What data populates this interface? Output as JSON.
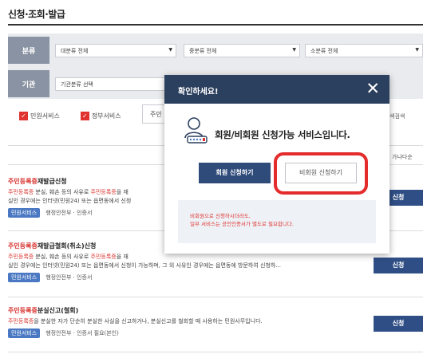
{
  "page": {
    "title": "신청·조회·발급"
  },
  "filters": {
    "category_label": "분류",
    "agency_label": "기관",
    "major_select": "대분류 전체",
    "middle_select": "중분류 전체",
    "minor_select": "소분류 전체",
    "agency_select": "기관분류 선택",
    "check_civil": "민원서비스",
    "check_gov": "정부서비스",
    "chip_partial": "주민",
    "detail_search": "색검색",
    "sort_partial": "가나다순"
  },
  "results": [
    {
      "title_hl": "주민등록증",
      "title_rest": "재발급신청",
      "desc1_hl": "주민등록증",
      "desc1_mid": " 분실, 훼손 등의 사유로 ",
      "desc1_hl2": "주민등록증",
      "desc1_rest": "을 재",
      "desc2": "실인 경우에는 인터넷(민원24) 또는 읍면동에서 신청",
      "tag": "민원서비스",
      "meta": "행정안전부 · 인증서",
      "button": "신청"
    },
    {
      "title_hl": "주민등록증",
      "title_rest": "재발급철회(취소)신청",
      "desc1_hl": "주민등록증",
      "desc1_mid": " 분실, 훼손 등의 사유로 ",
      "desc1_hl2": "주민등록증",
      "desc1_rest": "을 재",
      "desc2": "실인 경우에는 인터넷(민원24) 또는 읍면동에서 신청이 가능하며, 그 외 사유인 경우에는 읍면동에 방문하여 신청하...",
      "tag": "민원서비스",
      "meta": "행정안전부 · 인증서",
      "button": "신청"
    },
    {
      "title_hl": "주민등록증",
      "title_rest": "분실신고(철회)",
      "desc1_hl": "주민등록증",
      "desc1_mid": "을 분실한 자가 단순히 분실한 사실을 신고하거나, 분실신고를 철회할 때 사용하는 민원사무입니다.",
      "desc1_hl2": "",
      "desc1_rest": "",
      "desc2": "",
      "tag": "민원서비스",
      "meta": "행정안전부 · 인증서 필요(본인)",
      "button": "신청"
    }
  ],
  "modal": {
    "title": "확인하세요!",
    "close": "✕",
    "headline": "회원/비회원 신청가능 서비스입니다.",
    "member_button": "회원 신청하기",
    "nonmember_button": "비회원 신청하기",
    "notice_line1": "비회원으로 신청하시더라도,",
    "notice_line2": "일부 서비스는 공인인증서가 별도로 필요합니다."
  },
  "colors": {
    "modal_header": "#2b3f5e",
    "primary_button": "#2f4b7a",
    "highlight": "#e52c2c",
    "keyword": "#d8342f",
    "tag": "#4a78c2"
  }
}
